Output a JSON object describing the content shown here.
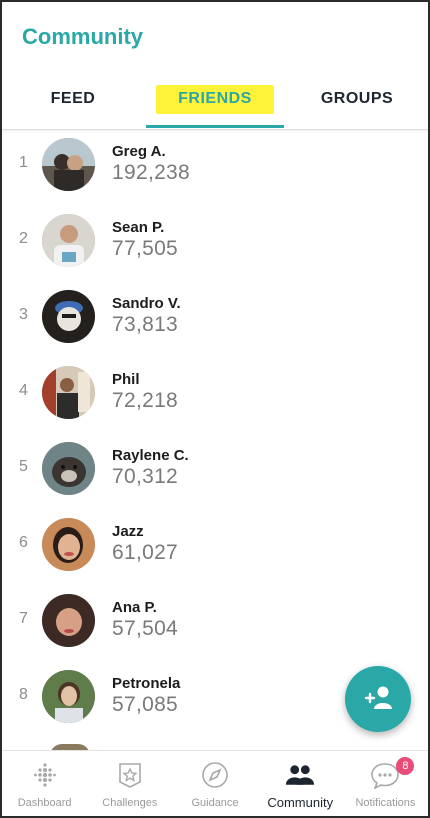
{
  "header": {
    "title": "Community"
  },
  "tabs": [
    {
      "label": "FEED",
      "active": false
    },
    {
      "label": "FRIENDS",
      "active": true
    },
    {
      "label": "GROUPS",
      "active": false
    }
  ],
  "leaderboard": [
    {
      "rank": "1",
      "name": "Greg A.",
      "steps": "192,238"
    },
    {
      "rank": "2",
      "name": "Sean P.",
      "steps": "77,505"
    },
    {
      "rank": "3",
      "name": "Sandro V.",
      "steps": "73,813"
    },
    {
      "rank": "4",
      "name": "Phil",
      "steps": "72,218"
    },
    {
      "rank": "5",
      "name": "Raylene C.",
      "steps": "70,312"
    },
    {
      "rank": "6",
      "name": "Jazz",
      "steps": "61,027"
    },
    {
      "rank": "7",
      "name": "Ana P.",
      "steps": "57,504"
    },
    {
      "rank": "8",
      "name": "Petronela",
      "steps": "57,085"
    }
  ],
  "fab": {
    "icon": "add-friend-icon"
  },
  "bottom_nav": [
    {
      "label": "Dashboard",
      "icon": "dashboard-icon",
      "active": false
    },
    {
      "label": "Challenges",
      "icon": "star-icon",
      "active": false
    },
    {
      "label": "Guidance",
      "icon": "compass-icon",
      "active": false
    },
    {
      "label": "Community",
      "icon": "people-icon",
      "active": true
    },
    {
      "label": "Notifications",
      "icon": "chat-bubble-icon",
      "active": false,
      "badge": "8"
    }
  ],
  "colors": {
    "accent": "#2aa7a7",
    "highlight": "#fff33a",
    "badge": "#e84d77",
    "text_dark": "#1d2630",
    "text_muted": "#7a7a7a"
  }
}
